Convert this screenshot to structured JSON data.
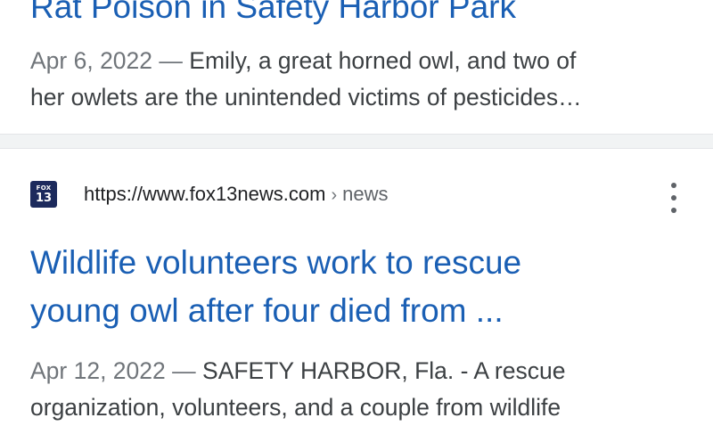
{
  "results": [
    {
      "title": "Rat Poison in Safety Harbor Park",
      "date": "Apr 6, 2022",
      "dash": "—",
      "snippet_line1": "Emily, a great horned owl, and two of",
      "snippet_line2": "her owlets are the unintended victims of pesticides…"
    },
    {
      "favicon_top": "FOX",
      "favicon_num": "13",
      "favicon_icon": "fox13-favicon",
      "url": "https://www.fox13news.com",
      "breadcrumb_sep": "›",
      "breadcrumb": "news",
      "title_line1": "Wildlife volunteers work to rescue",
      "title_line2": "young owl after four died from ...",
      "date": "Apr 12, 2022",
      "dash": "—",
      "snippet_line1": "SAFETY HARBOR, Fla. - A rescue",
      "snippet_line2": "organization, volunteers, and a couple from wildlife"
    }
  ],
  "colors": {
    "link": "#1a5fb4",
    "text": "#3c4043",
    "muted": "#70757a",
    "divider": "#f1f3f4"
  }
}
